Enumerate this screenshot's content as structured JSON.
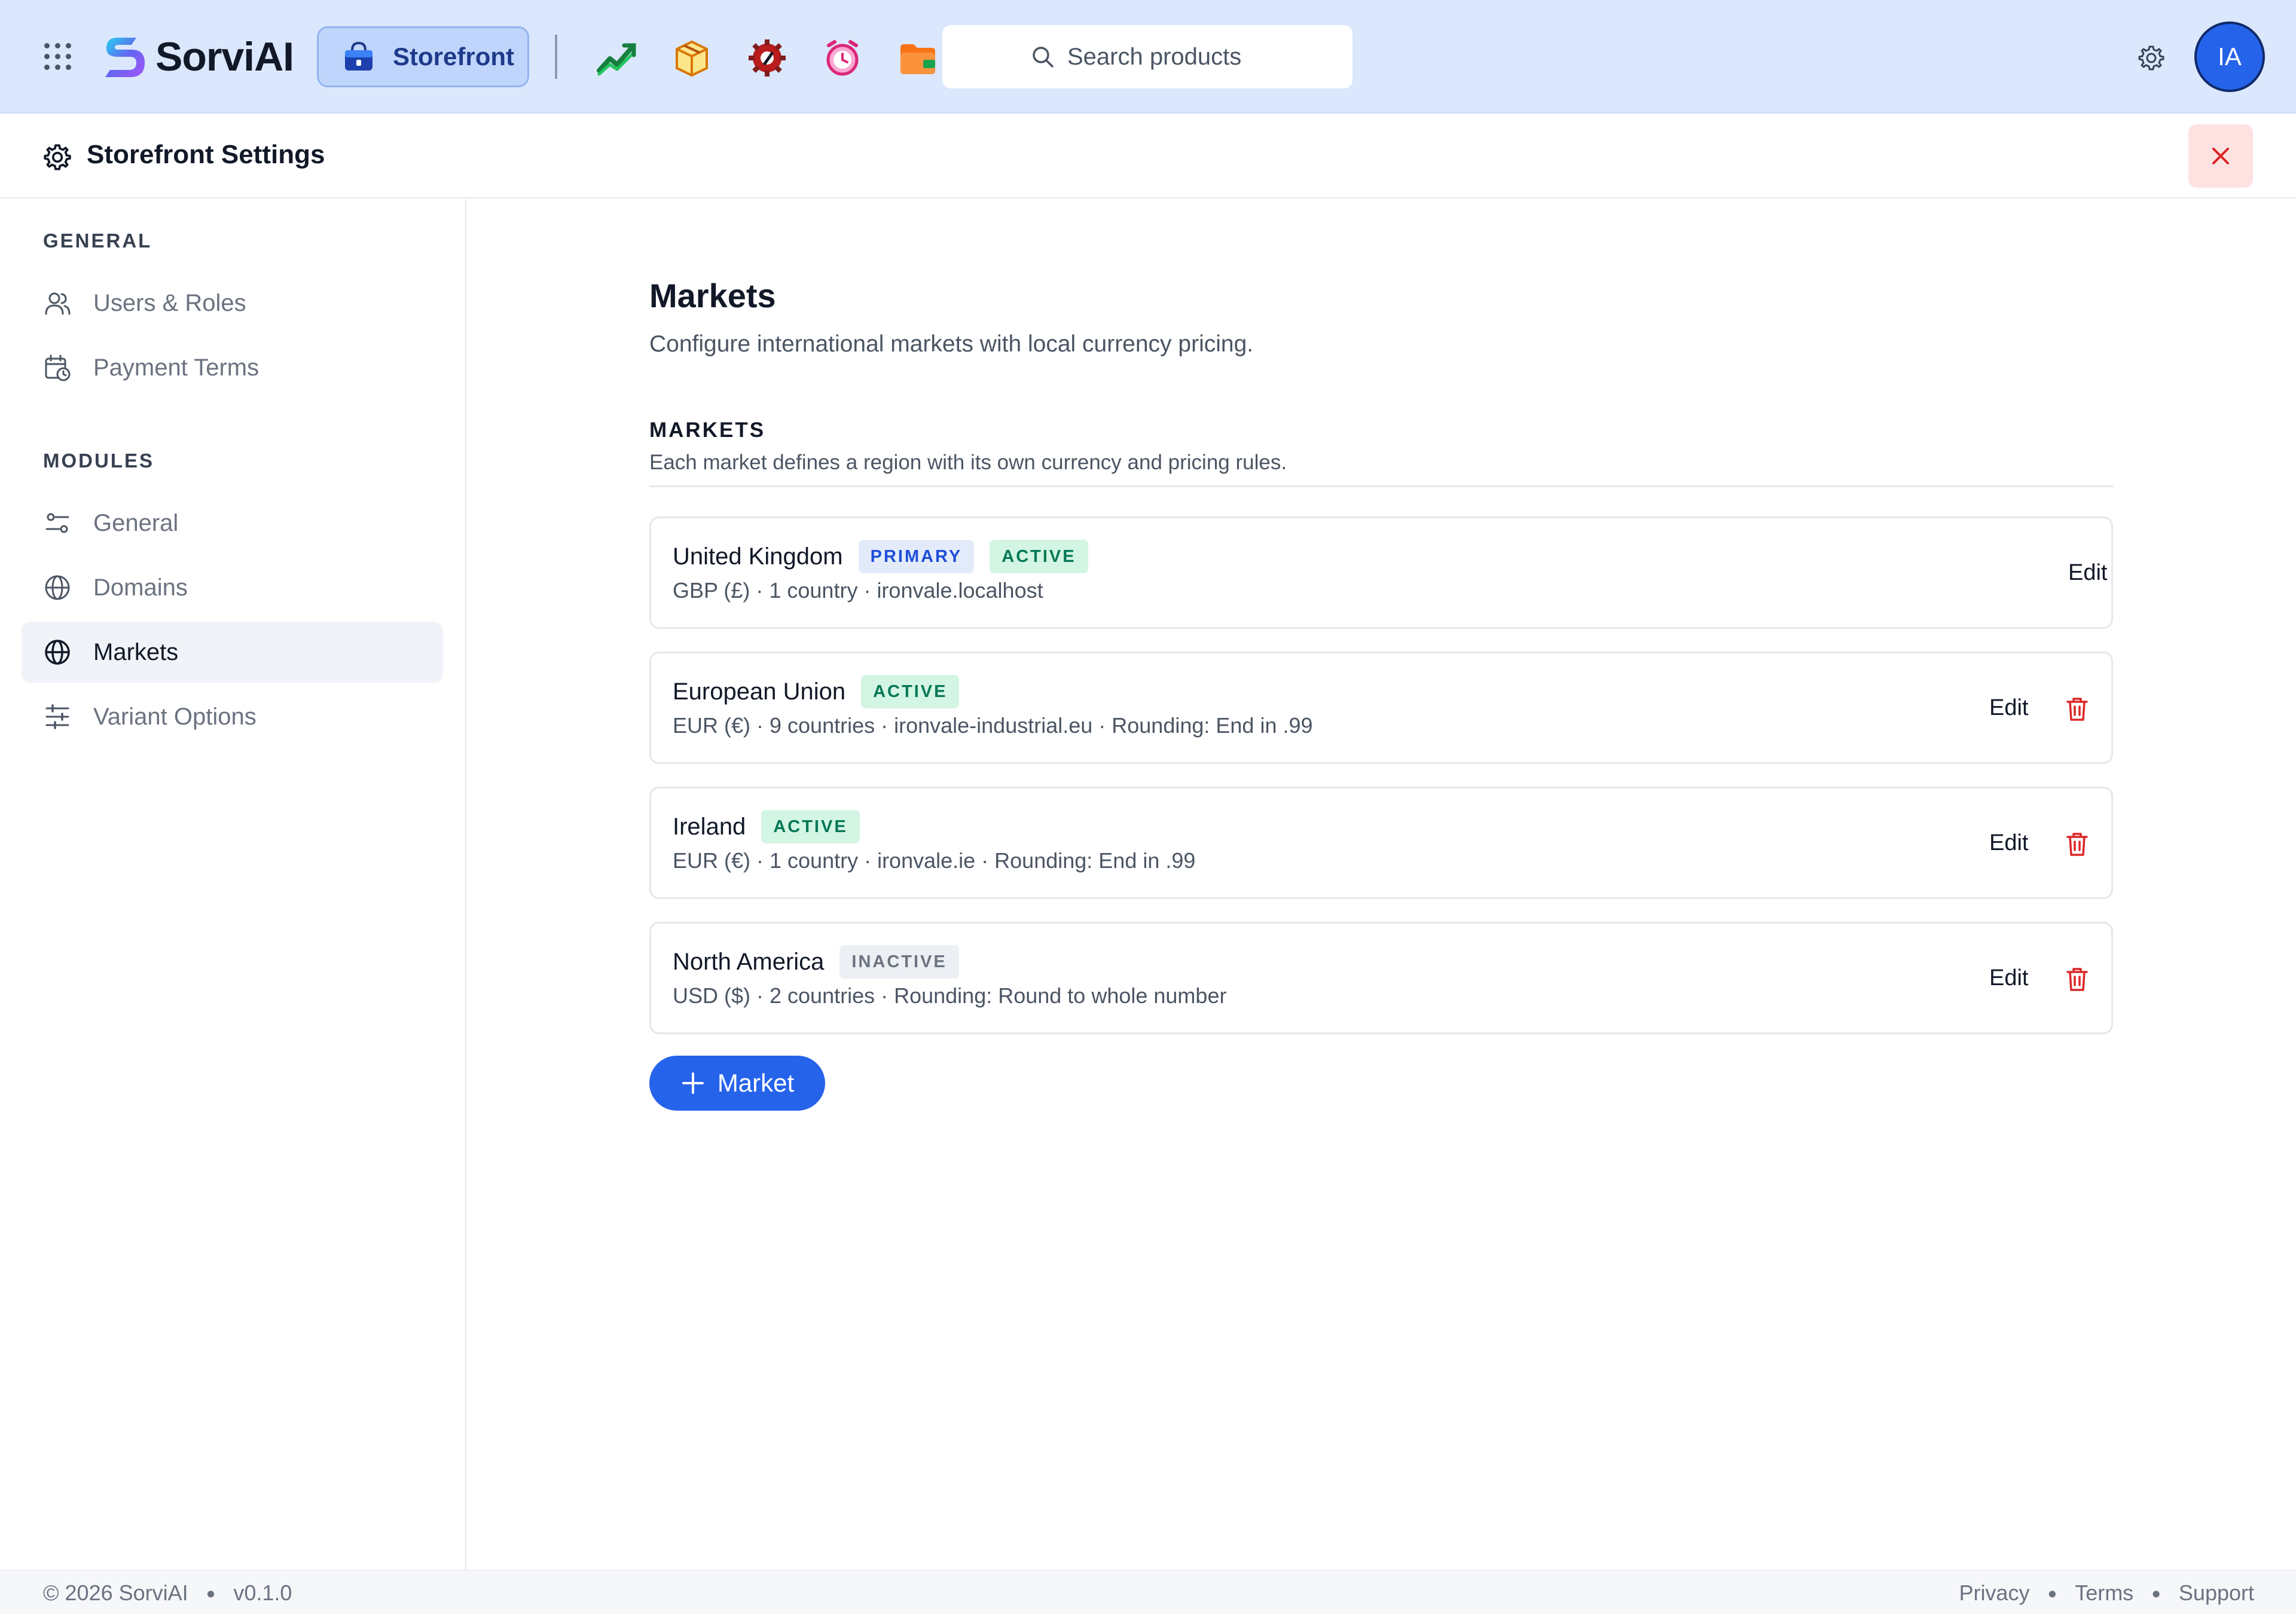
{
  "topbar": {
    "brand_name": "SorviAI",
    "active_app": "Storefront",
    "search_placeholder": "Search products",
    "avatar_initials": "IA",
    "apps": [
      "chart-trend-icon",
      "package-box-icon",
      "service-gear-icon",
      "alarm-clock-icon",
      "folder-wallet-icon"
    ]
  },
  "header": {
    "title": "Storefront Settings"
  },
  "sidebar": {
    "sections": [
      {
        "title": "GENERAL",
        "items": [
          {
            "label": "Users & Roles",
            "icon": "users-icon"
          },
          {
            "label": "Payment Terms",
            "icon": "calendar-clock-icon"
          }
        ]
      },
      {
        "title": "MODULES",
        "items": [
          {
            "label": "General",
            "icon": "toggles-icon"
          },
          {
            "label": "Domains",
            "icon": "globe-icon"
          },
          {
            "label": "Markets",
            "icon": "globe-icon",
            "active": true
          },
          {
            "label": "Variant Options",
            "icon": "sliders-icon"
          }
        ]
      }
    ]
  },
  "main": {
    "title": "Markets",
    "subtitle": "Configure international markets with local currency pricing.",
    "section_title": "MARKETS",
    "section_desc": "Each market defines a region with its own currency and pricing rules.",
    "edit_label": "Edit",
    "markets": [
      {
        "name": "United Kingdom",
        "badges": [
          "PRIMARY",
          "ACTIVE"
        ],
        "meta": "GBP (£) · 1 country · ironvale.localhost",
        "deletable": false
      },
      {
        "name": "European Union",
        "badges": [
          "ACTIVE"
        ],
        "meta": "EUR (€) · 9 countries · ironvale-industrial.eu · Rounding: End in .99",
        "deletable": true
      },
      {
        "name": "Ireland",
        "badges": [
          "ACTIVE"
        ],
        "meta": "EUR (€) · 1 country · ironvale.ie · Rounding: End in .99",
        "deletable": true
      },
      {
        "name": "North America",
        "badges": [
          "INACTIVE"
        ],
        "meta": "USD ($) · 2 countries · Rounding: Round to whole number",
        "deletable": true
      }
    ],
    "add_button_label": "Market"
  },
  "footer": {
    "copyright": "© 2026 SorviAI",
    "version": "v0.1.0",
    "links": [
      "Privacy",
      "Terms",
      "Support"
    ]
  },
  "colors": {
    "topbar_bg": "#dbe7fd",
    "accent": "#2563eb",
    "danger": "#dc2626",
    "active_badge": "#047857",
    "primary_badge": "#1d4ed8"
  }
}
